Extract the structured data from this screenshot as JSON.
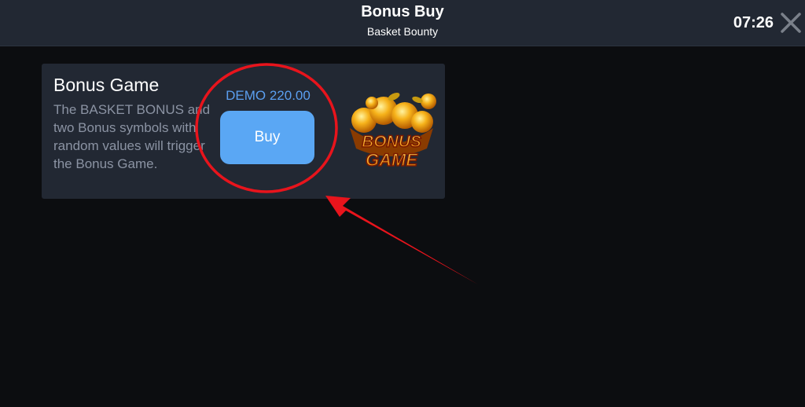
{
  "header": {
    "title": "Bonus Buy",
    "subtitle": "Basket Bounty",
    "time": "07:26",
    "close_icon": "close-icon"
  },
  "card": {
    "title": "Bonus Game",
    "description": "The BASKET BONUS and two Bonus symbols with random values will trigger the Bonus Game.",
    "price": "DEMO 220.00",
    "buy_label": "Buy",
    "image_caption": "BONUS GAME"
  },
  "colors": {
    "background": "#0c0d10",
    "panel": "#222833",
    "price_text": "#5b9ff0",
    "button": "#5aa7f4",
    "description_text": "#8b93a3",
    "annotation_red": "#e8141c"
  }
}
